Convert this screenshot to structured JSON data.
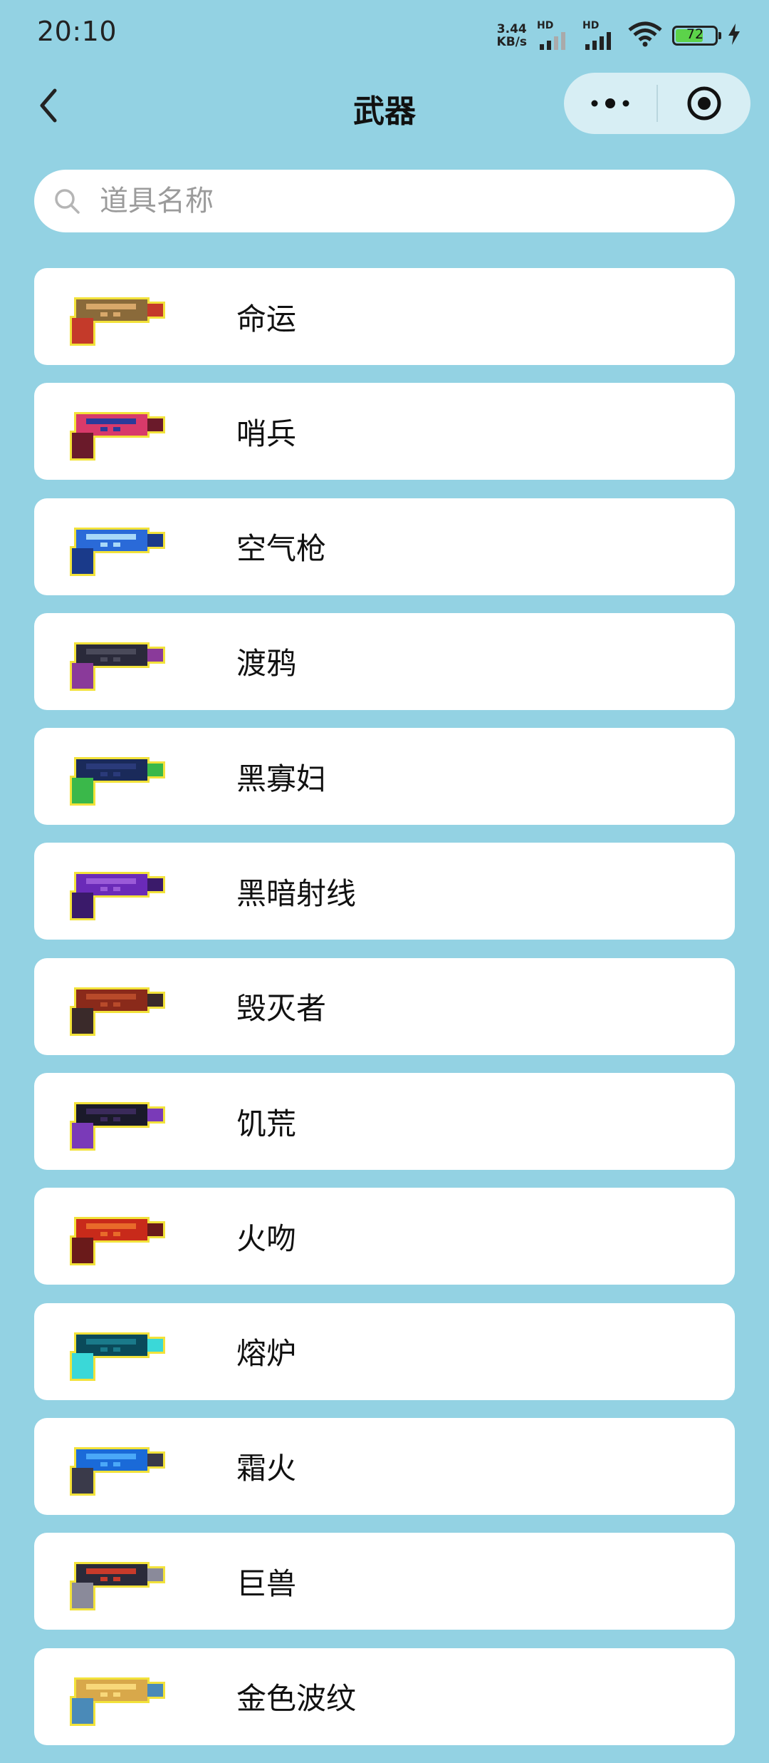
{
  "status_bar": {
    "time": "20:10",
    "net_speed_value": "3.44",
    "net_speed_unit": "KB/s",
    "sim1_label": "HD",
    "sim2_label": "HD",
    "battery_level": "72",
    "battery_color": "#5cd34a"
  },
  "nav": {
    "title": "武器",
    "more_icon": "more-dots-icon",
    "close_icon": "target-circle-icon"
  },
  "search": {
    "placeholder": "道具名称",
    "value": ""
  },
  "weapons": [
    {
      "name": "命运",
      "icon": "destiny-gun-icon",
      "colors": [
        "#8a6a3a",
        "#d8a86a",
        "#c43a2a"
      ]
    },
    {
      "name": "哨兵",
      "icon": "sentinel-gun-icon",
      "colors": [
        "#d83a6a",
        "#2a3a9a",
        "#6a1a2a"
      ]
    },
    {
      "name": "空气枪",
      "icon": "air-gun-icon",
      "colors": [
        "#2a6ad8",
        "#a8d8f8",
        "#1a3a8a"
      ]
    },
    {
      "name": "渡鸦",
      "icon": "raven-gun-icon",
      "colors": [
        "#2a2a3a",
        "#4a4a5a",
        "#8a3a9a"
      ]
    },
    {
      "name": "黑寡妇",
      "icon": "black-widow-gun-icon",
      "colors": [
        "#1a2a5a",
        "#2a3a7a",
        "#3ab84a"
      ]
    },
    {
      "name": "黑暗射线",
      "icon": "dark-ray-gun-icon",
      "colors": [
        "#6a2ab8",
        "#9a5ad8",
        "#3a1a6a"
      ]
    },
    {
      "name": "毁灭者",
      "icon": "destroyer-gun-icon",
      "colors": [
        "#8a2a1a",
        "#b84a2a",
        "#3a2a2a"
      ]
    },
    {
      "name": "饥荒",
      "icon": "famine-gun-icon",
      "colors": [
        "#1a1a2a",
        "#3a2a5a",
        "#7a3ab8"
      ]
    },
    {
      "name": "火吻",
      "icon": "fire-kiss-gun-icon",
      "colors": [
        "#c82a1a",
        "#e86a2a",
        "#6a1a1a"
      ]
    },
    {
      "name": "熔炉",
      "icon": "furnace-gun-icon",
      "colors": [
        "#0a4a5a",
        "#1a7a8a",
        "#3ad8d8"
      ]
    },
    {
      "name": "霜火",
      "icon": "frostfire-gun-icon",
      "colors": [
        "#1a6ad8",
        "#4aa8f8",
        "#3a3a4a"
      ]
    },
    {
      "name": "巨兽",
      "icon": "behemoth-gun-icon",
      "colors": [
        "#2a2a3a",
        "#c83a2a",
        "#8a8a9a"
      ]
    },
    {
      "name": "金色波纹",
      "icon": "golden-ripple-gun-icon",
      "colors": [
        "#d8a84a",
        "#f8d87a",
        "#4a8ab8"
      ]
    }
  ]
}
